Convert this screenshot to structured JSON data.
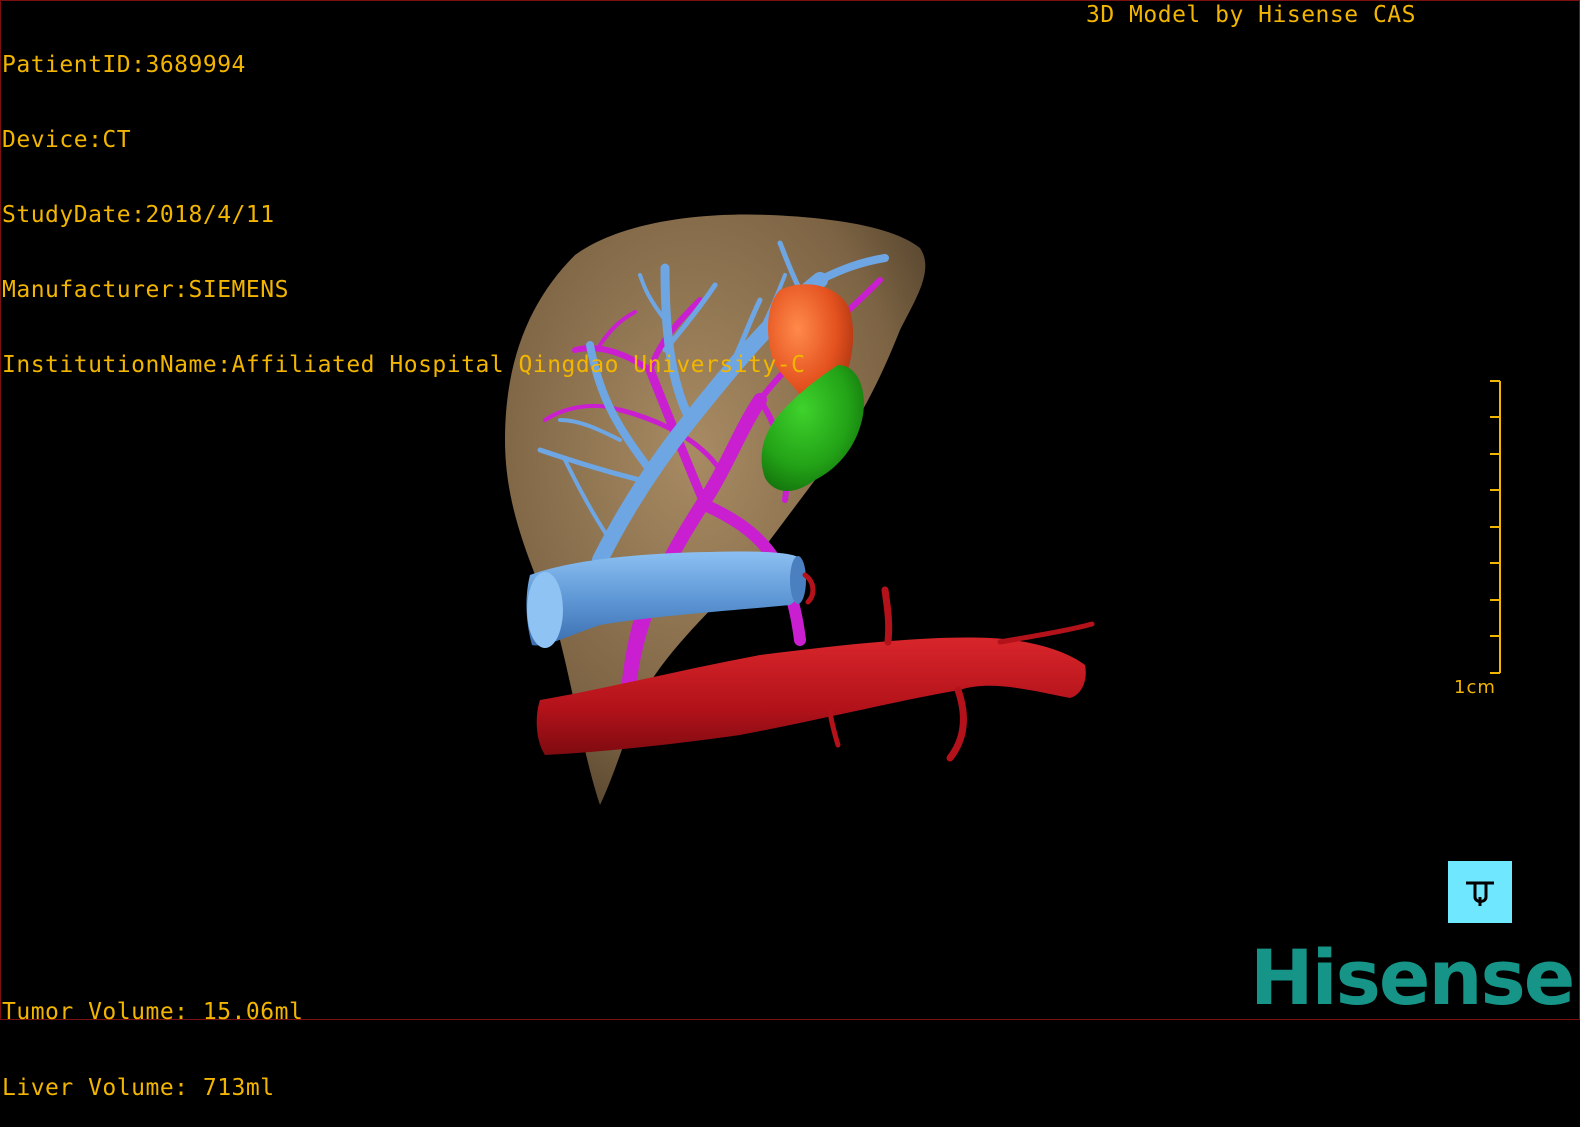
{
  "header": {
    "patient_id": "PatientID:3689994",
    "device": "Device:CT",
    "study_date": "StudyDate:2018/4/11",
    "manufacturer": "Manufacturer:SIEMENS",
    "institution": "InstitutionName:Affiliated Hospital Qingdao University-C",
    "model_by": "3D Model by Hisense CAS"
  },
  "footer": {
    "tumor_volume": "Tumor Volume: 15.06ml",
    "liver_volume": "Liver Volume: 713ml"
  },
  "scale_bar": {
    "label": "1cm"
  },
  "logo": {
    "text": "Hisense",
    "color": "#169488"
  },
  "colors": {
    "overlay_text": "#f2b500",
    "liver": "#8a6f4a",
    "hepatic_vein": "#5f98d6",
    "portal_vein": "#c91fd1",
    "tumor": "#e4521f",
    "gallbladder": "#23a317",
    "artery": "#b3121a",
    "orientation_button": "#6fe8ff"
  },
  "orientation_button": {
    "icon": "orientation-cube-icon"
  }
}
